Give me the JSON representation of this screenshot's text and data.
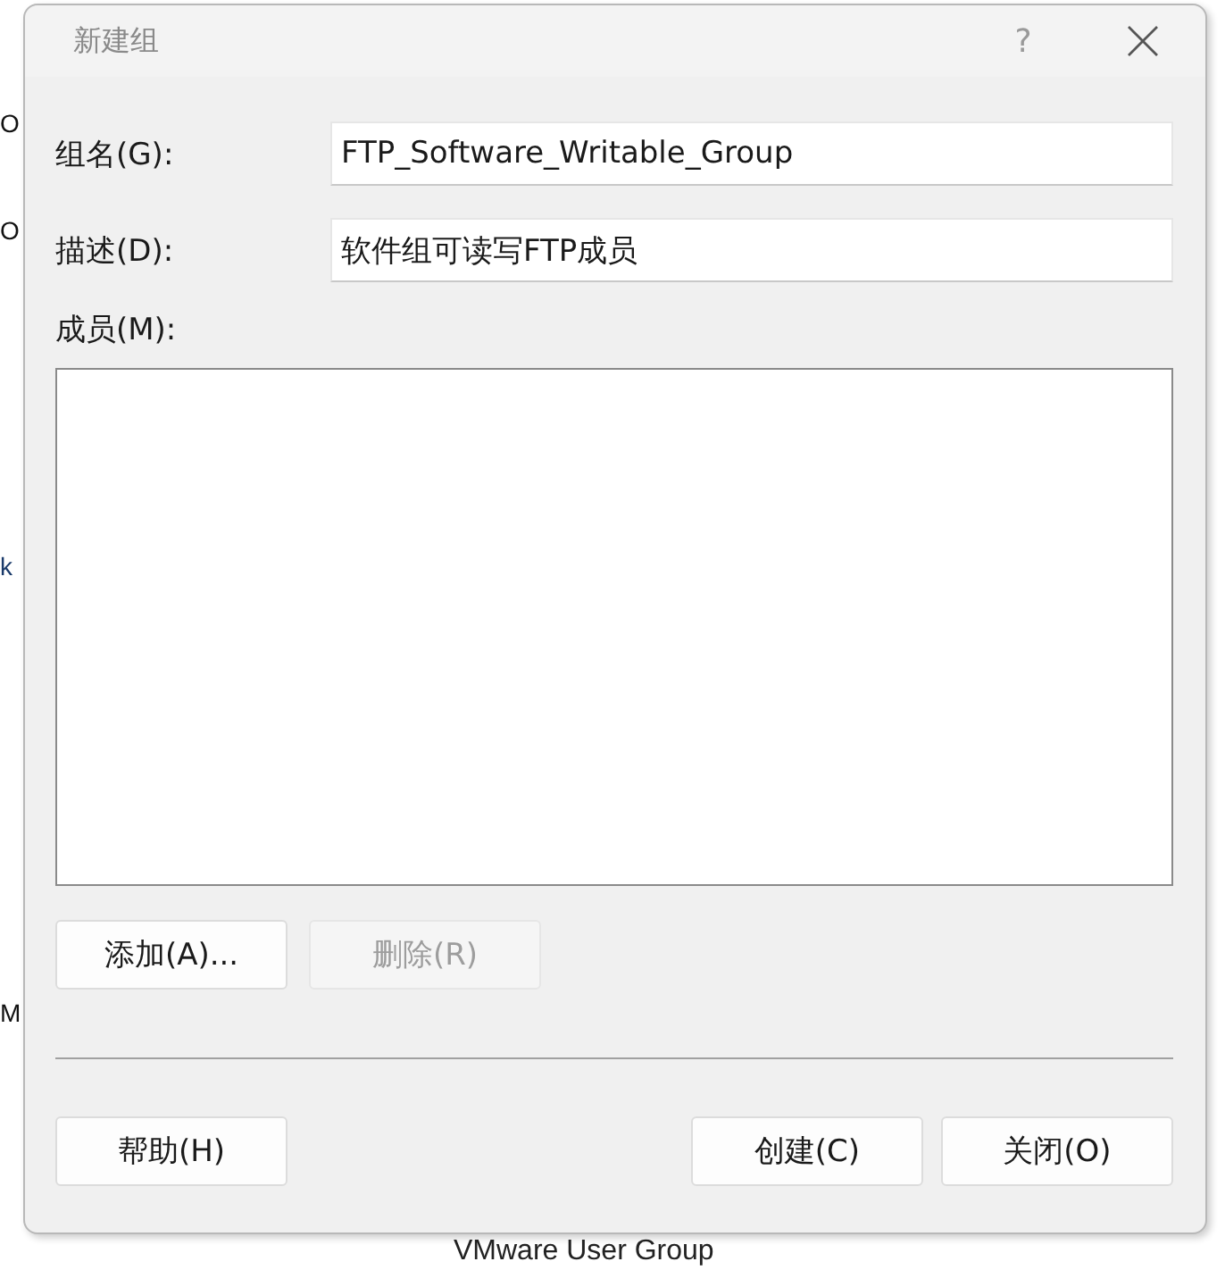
{
  "background_window": {
    "fragments": [
      "O",
      "O",
      "k",
      "M"
    ],
    "bottom_text": "VMware User Group"
  },
  "dialog": {
    "title": "新建组",
    "help_glyph": "?",
    "fields": [
      {
        "label": "组名(G):",
        "value": "FTP_Software_Writable_Group"
      },
      {
        "label": "描述(D):",
        "value": "软件组可读写FTP成员"
      }
    ],
    "members_label": "成员(M):",
    "member_buttons": [
      {
        "label": "添加(A)...",
        "disabled": false
      },
      {
        "label": "删除(R)",
        "disabled": true
      }
    ],
    "footer_buttons": [
      {
        "label": "帮助(H)"
      },
      {
        "label": "创建(C)"
      },
      {
        "label": "关闭(O)"
      }
    ]
  }
}
